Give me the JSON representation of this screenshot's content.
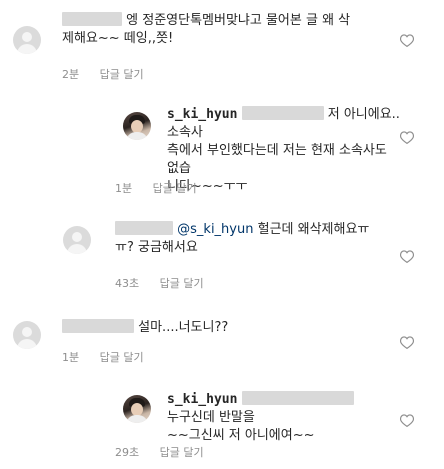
{
  "comments": [
    {
      "username": "",
      "text": "엥 정준영단톡멤버맞냐고 물어본 글 왜 삭제해요~~ 떼잉,,쯧!",
      "line1": "엥 정준영단톡멤버맞냐고 물어본 글 왜 삭",
      "line2": "제해요~~ 떼잉,,쯧!",
      "time": "2분",
      "reply_label": "답글 달기"
    },
    {
      "username": "s_ki_hyun",
      "text": "저 아니에요..소속사 측에서 부인했다는데 저는 현재 소속사도 없습니다~~~ㅜㅜ",
      "line1": "저 아니에요..소속사",
      "line2": "측에서 부인했다는데 저는 현재 소속사도 없습",
      "line3": "니다~~~ㅜㅜ",
      "time": "1분",
      "reply_label": "답글 달기"
    },
    {
      "username": "",
      "mention": "@s_ki_hyun",
      "text": "헐근데 왜삭제해요ㅠㅠ? 궁금해서요",
      "line1": "헐근데 왜삭제해요ㅠ",
      "line2": "ㅠ? 궁금해서요",
      "time": "43초",
      "reply_label": "답글 달기"
    },
    {
      "username": "",
      "text": "설마....너도니??",
      "time": "1분",
      "reply_label": "답글 달기"
    },
    {
      "username": "s_ki_hyun",
      "text": "누구신데 반말을 ~~그신씨 저 아니에여~~",
      "line1": "누구신데 반말을",
      "line2": "~~그신씨 저 아니에여~~",
      "time": "29초",
      "reply_label": "답글 달기"
    }
  ],
  "icons": {
    "like": "heart-outline-icon",
    "avatar_default": "default-avatar-icon",
    "avatar_user": "user-photo-avatar"
  },
  "colors": {
    "text": "#262626",
    "meta": "#8e8e8e",
    "mention": "#003569",
    "redaction": "#d9d9d9"
  }
}
